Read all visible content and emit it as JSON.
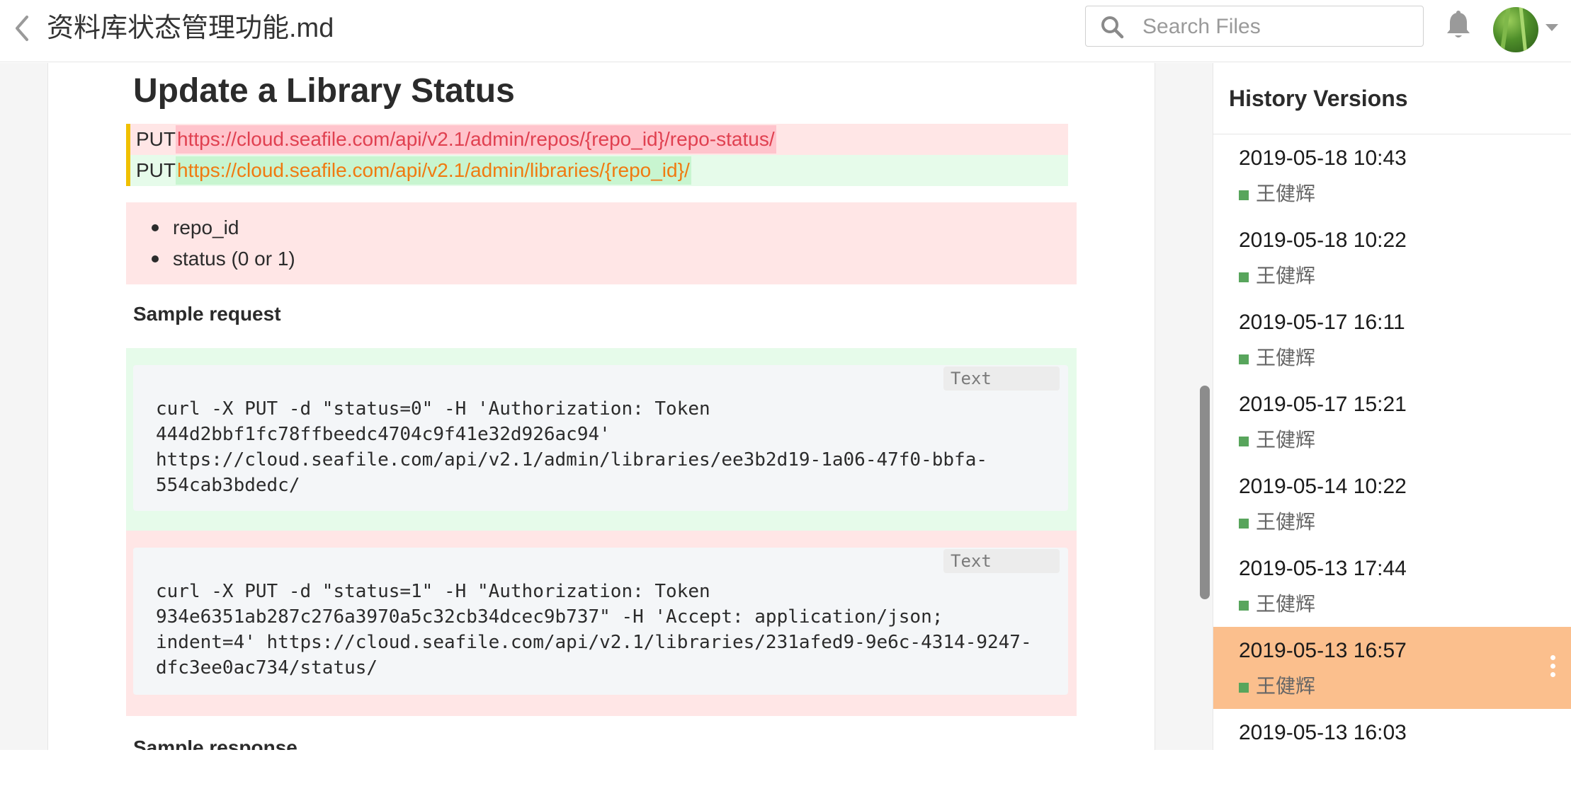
{
  "header": {
    "title": "资料库状态管理功能.md",
    "search_placeholder": "Search Files"
  },
  "document": {
    "heading": "Update a Library Status",
    "put_rows": [
      {
        "method": "PUT",
        "url": "https://cloud.seafile.com/api/v2.1/admin/repos/{repo_id}/repo-status/",
        "change": "deleted"
      },
      {
        "method": "PUT",
        "url": "https://cloud.seafile.com/api/v2.1/admin/libraries/{repo_id}/",
        "change": "inserted"
      }
    ],
    "params": [
      "repo_id",
      "status (0 or 1)"
    ],
    "sample_request_label": "Sample request",
    "code_blocks": [
      {
        "lang": "Text",
        "change": "inserted",
        "lines": [
          "curl -X PUT -d \"status=0\" -H 'Authorization: Token",
          "444d2bbf1fc78ffbeedc4704c9f41e32d926ac94'",
          "https://cloud.seafile.com/api/v2.1/admin/libraries/ee3b2d19-1a06-47f0-bbfa-",
          "554cab3bdedc/"
        ]
      },
      {
        "lang": "Text",
        "change": "deleted",
        "lines": [
          "curl -X PUT -d \"status=1\" -H \"Authorization: Token",
          "934e6351ab287c276a3970a5c32cb34dcec9b737\" -H 'Accept: application/json;",
          "indent=4' https://cloud.seafile.com/api/v2.1/libraries/231afed9-9e6c-4314-9247-",
          "dfc3ee0ac734/status/"
        ]
      }
    ],
    "sample_response_label": "Sample response"
  },
  "sidebar": {
    "title": "History Versions",
    "versions": [
      {
        "date": "2019-05-18 10:43",
        "author": "王健辉",
        "active": false
      },
      {
        "date": "2019-05-18 10:22",
        "author": "王健辉",
        "active": false
      },
      {
        "date": "2019-05-17 16:11",
        "author": "王健辉",
        "active": false
      },
      {
        "date": "2019-05-17 15:21",
        "author": "王健辉",
        "active": false
      },
      {
        "date": "2019-05-14 10:22",
        "author": "王健辉",
        "active": false
      },
      {
        "date": "2019-05-13 17:44",
        "author": "王健辉",
        "active": false
      },
      {
        "date": "2019-05-13 16:57",
        "author": "王健辉",
        "active": true
      },
      {
        "date": "2019-05-13 16:03",
        "author": "",
        "active": false
      }
    ]
  },
  "colors": {
    "deleted_bg": "#ffe6e6",
    "inserted_bg": "#e6fbea",
    "active_version_bg": "#fbbf8d",
    "author_marker": "#58a55c"
  },
  "icons": {
    "back": "chevron-left-icon",
    "search": "search-icon",
    "notifications": "bell-icon",
    "more": "more-vertical-icon"
  }
}
